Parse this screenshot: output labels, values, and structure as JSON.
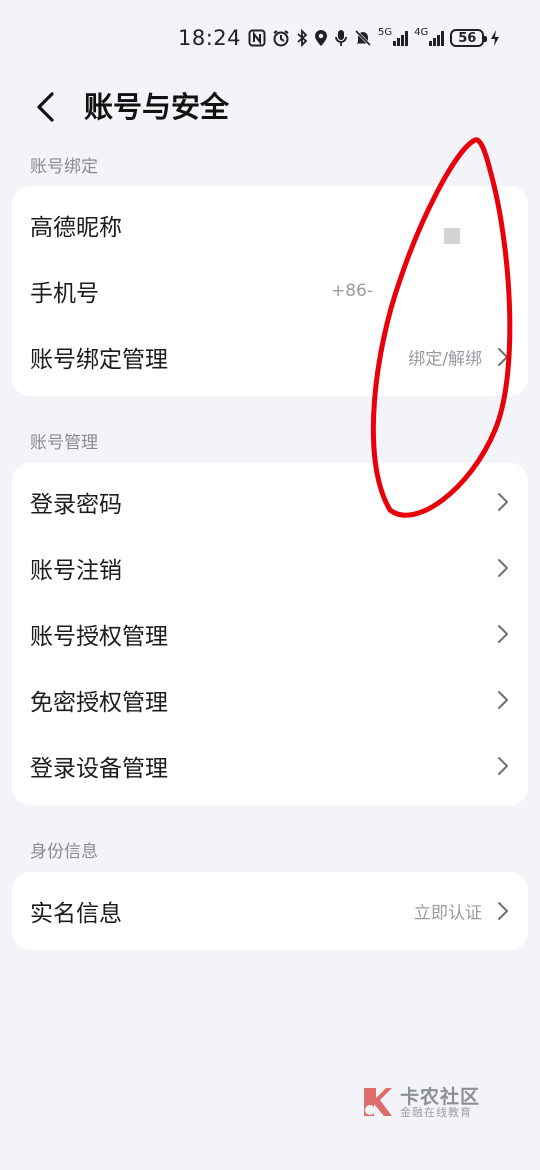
{
  "status_bar": {
    "time": "18:24",
    "network_1": "5G",
    "network_2": "4G",
    "battery": "56",
    "icons": [
      "nfc-icon",
      "alarm-icon",
      "bluetooth-icon",
      "location-icon",
      "microphone-icon",
      "mute-icon",
      "charging-icon"
    ]
  },
  "header": {
    "back_icon": "back-arrow-icon",
    "title": "账号与安全"
  },
  "sections": {
    "binding": {
      "label": "账号绑定",
      "rows": [
        {
          "label": "高德昵称",
          "value": ""
        },
        {
          "label": "手机号",
          "value": "+86-"
        },
        {
          "label": "账号绑定管理",
          "value": "绑定/解绑"
        }
      ]
    },
    "management": {
      "label": "账号管理",
      "rows": [
        {
          "label": "登录密码"
        },
        {
          "label": "账号注销"
        },
        {
          "label": "账号授权管理"
        },
        {
          "label": "免密授权管理"
        },
        {
          "label": "登录设备管理"
        }
      ]
    },
    "identity": {
      "label": "身份信息",
      "rows": [
        {
          "label": "实名信息",
          "value": "立即认证"
        }
      ]
    }
  },
  "watermark": {
    "title": "卡农社区",
    "subtitle": "金融在线教育"
  },
  "colors": {
    "background": "#f3f4f8",
    "card": "#ffffff",
    "annotation": "#e8000b",
    "secondary_text": "#9a9aa0"
  }
}
